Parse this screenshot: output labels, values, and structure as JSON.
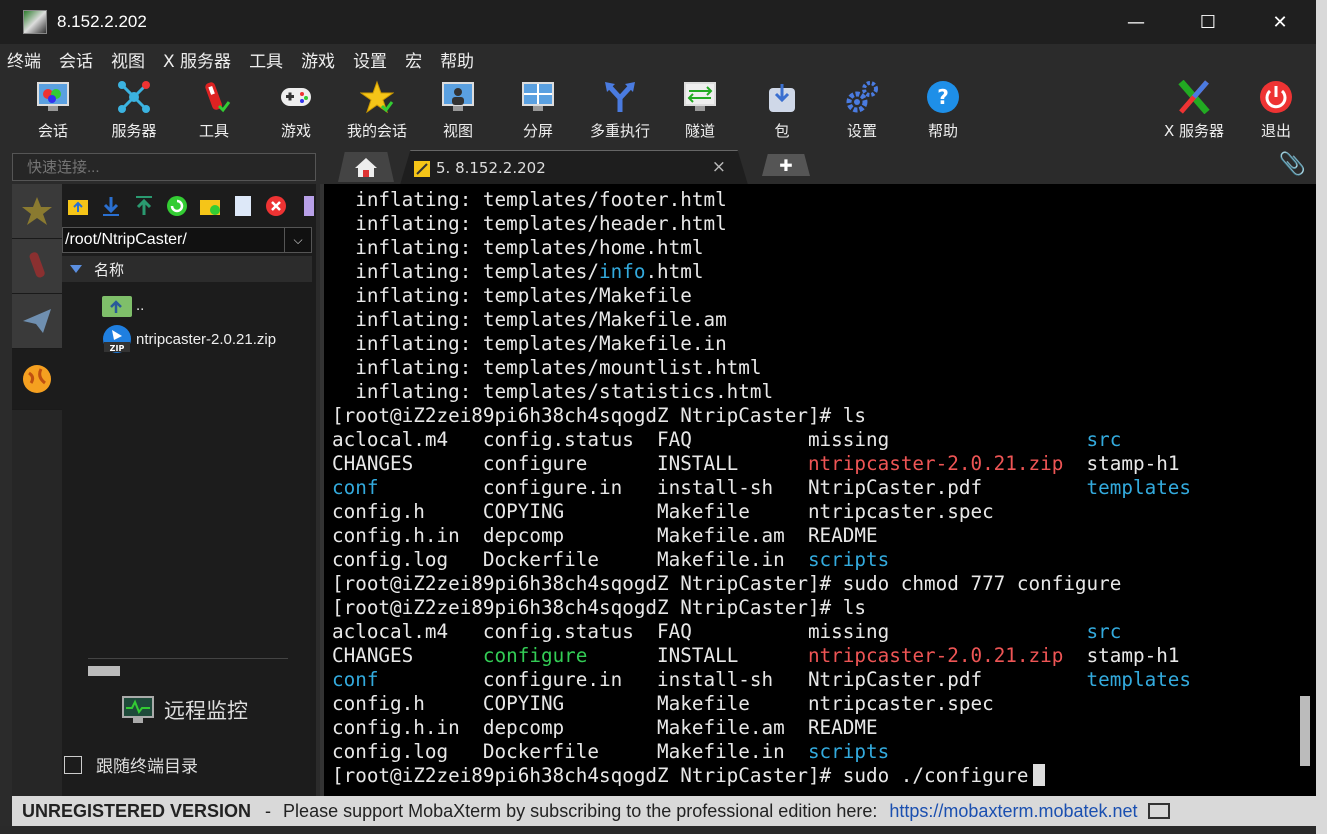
{
  "window": {
    "title": "8.152.2.202",
    "controls": [
      "minimize",
      "maximize",
      "close"
    ]
  },
  "menu": [
    "终端",
    "会话",
    "视图",
    "X 服务器",
    "工具",
    "游戏",
    "设置",
    "宏",
    "帮助"
  ],
  "toolbar": [
    {
      "label": "会话",
      "icon": "session-icon"
    },
    {
      "label": "服务器",
      "icon": "servers-icon"
    },
    {
      "label": "工具",
      "icon": "tools-icon"
    },
    {
      "label": "游戏",
      "icon": "games-icon"
    },
    {
      "label": "我的会话",
      "icon": "sessions-star-icon"
    },
    {
      "label": "视图",
      "icon": "view-icon"
    },
    {
      "label": "分屏",
      "icon": "split-icon"
    },
    {
      "label": "多重执行",
      "icon": "multiexec-icon"
    },
    {
      "label": "隧道",
      "icon": "tunneling-icon"
    },
    {
      "label": "包",
      "icon": "packages-icon"
    },
    {
      "label": "设置",
      "icon": "settings-icon"
    },
    {
      "label": "帮助",
      "icon": "help-icon"
    },
    {
      "label": "X 服务器",
      "icon": "xserver-icon"
    },
    {
      "label": "退出",
      "icon": "exit-icon"
    }
  ],
  "quick_connect": {
    "placeholder": "快速连接..."
  },
  "tabs": {
    "active": "5. 8.152.2.202",
    "close": "×",
    "add": "✚"
  },
  "sidebar": {
    "path": "/root/NtripCaster/",
    "column_name": "名称",
    "files": [
      {
        "name": "..",
        "icon": "parent-folder-icon"
      },
      {
        "name": "ntripcaster-2.0.21.zip",
        "icon": "zip-file-icon"
      }
    ],
    "remote_monitoring": "远程监控",
    "follow_terminal": "跟随终端目录"
  },
  "terminal": {
    "lines": [
      [
        {
          "t": "  inflating: templates/footer.html"
        }
      ],
      [
        {
          "t": "  inflating: templates/header.html"
        }
      ],
      [
        {
          "t": "  inflating: templates/home.html"
        }
      ],
      [
        {
          "t": "  inflating: templates/"
        },
        {
          "t": "info",
          "c": "cyan"
        },
        {
          "t": ".html"
        }
      ],
      [
        {
          "t": "  inflating: templates/Makefile"
        }
      ],
      [
        {
          "t": "  inflating: templates/Makefile.am"
        }
      ],
      [
        {
          "t": "  inflating: templates/Makefile.in"
        }
      ],
      [
        {
          "t": "  inflating: templates/mountlist.html"
        }
      ],
      [
        {
          "t": "  inflating: templates/statistics.html"
        }
      ],
      [
        {
          "t": "[root@iZ2zei89pi6h38ch4sqogdZ NtripCaster]# ls"
        }
      ],
      [
        {
          "t": "aclocal.m4   config.status  FAQ          missing                 "
        },
        {
          "t": "src",
          "c": "cyan"
        }
      ],
      [
        {
          "t": "CHANGES      configure      INSTALL      "
        },
        {
          "t": "ntripcaster-2.0.21.zip",
          "c": "red"
        },
        {
          "t": "  stamp-h1"
        }
      ],
      [
        {
          "t": "conf",
          "c": "cyan"
        },
        {
          "t": "         configure.in   install-sh   NtripCaster.pdf         "
        },
        {
          "t": "templates",
          "c": "cyan"
        }
      ],
      [
        {
          "t": "config.h     COPYING        Makefile     ntripcaster.spec"
        }
      ],
      [
        {
          "t": "config.h.in  depcomp        Makefile.am  README"
        }
      ],
      [
        {
          "t": "config.log   Dockerfile     Makefile.in  "
        },
        {
          "t": "scripts",
          "c": "cyan"
        }
      ],
      [
        {
          "t": "[root@iZ2zei89pi6h38ch4sqogdZ NtripCaster]# sudo chmod 777 configure"
        }
      ],
      [
        {
          "t": "[root@iZ2zei89pi6h38ch4sqogdZ NtripCaster]# ls"
        }
      ],
      [
        {
          "t": "aclocal.m4   config.status  FAQ          missing                 "
        },
        {
          "t": "src",
          "c": "cyan"
        }
      ],
      [
        {
          "t": "CHANGES      "
        },
        {
          "t": "configure",
          "c": "green"
        },
        {
          "t": "      INSTALL      "
        },
        {
          "t": "ntripcaster-2.0.21.zip",
          "c": "red"
        },
        {
          "t": "  stamp-h1"
        }
      ],
      [
        {
          "t": "conf",
          "c": "cyan"
        },
        {
          "t": "         configure.in   install-sh   NtripCaster.pdf         "
        },
        {
          "t": "templates",
          "c": "cyan"
        }
      ],
      [
        {
          "t": "config.h     COPYING        Makefile     ntripcaster.spec"
        }
      ],
      [
        {
          "t": "config.h.in  depcomp        Makefile.am  README"
        }
      ],
      [
        {
          "t": "config.log   Dockerfile     Makefile.in  "
        },
        {
          "t": "scripts",
          "c": "cyan"
        }
      ],
      [
        {
          "t": "[root@iZ2zei89pi6h38ch4sqogdZ NtripCaster]# sudo ./configure"
        }
      ]
    ]
  },
  "status": {
    "unregistered": "UNREGISTERED VERSION",
    "dash": "-",
    "message": "Please support MobaXterm by subscribing to the professional edition here:",
    "link": "https://mobaxterm.mobatek.net"
  },
  "colors": {
    "cyan": "#33aadd",
    "red": "#ee5555",
    "green": "#33cc55",
    "background": "#000000"
  }
}
